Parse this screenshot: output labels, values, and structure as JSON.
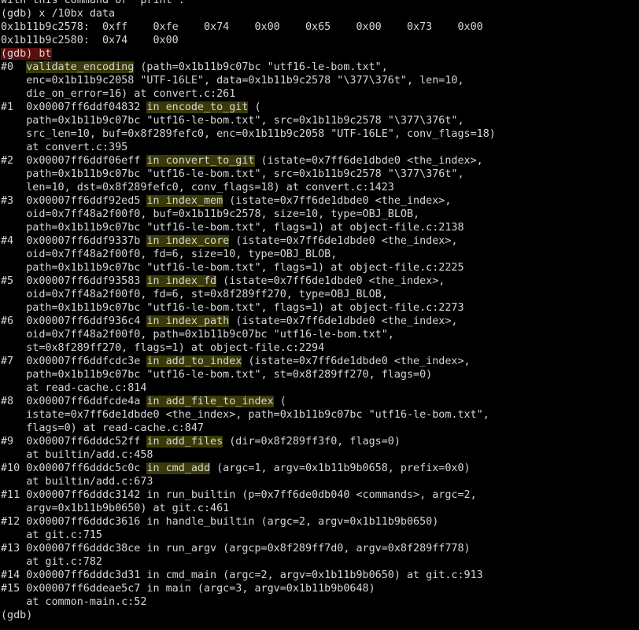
{
  "terminal": {
    "lines": [
      [
        {
          "t": "with this command or \"print\"."
        }
      ],
      [
        {
          "t": "(gdb) x /10bx data"
        }
      ],
      [
        {
          "t": "0x1b11b9c2578:  0xff    0xfe    0x74    0x00    0x65    0x00    0x73    0x00"
        }
      ],
      [
        {
          "t": "0x1b11b9c2580:  0x74    0x00"
        }
      ],
      [
        {
          "t": "(gdb) bt",
          "c": "prompt-hl"
        }
      ],
      [
        {
          "t": "#0  "
        },
        {
          "t": "validate_encoding",
          "c": "hl"
        },
        {
          "t": " (path=0x1b11b9c07bc \"utf16-le-bom.txt\","
        }
      ],
      [
        {
          "t": "    enc=0x1b11b9c2058 \"UTF-16LE\", data=0x1b11b9c2578 \"\\377\\376t\", len=10,"
        }
      ],
      [
        {
          "t": "    die_on_error=16) at convert.c:261"
        }
      ],
      [
        {
          "t": "#1  0x00007ff6ddf04832 "
        },
        {
          "t": "in encode_to_git",
          "c": "hl"
        },
        {
          "t": " ("
        }
      ],
      [
        {
          "t": "    path=0x1b11b9c07bc \"utf16-le-bom.txt\", src=0x1b11b9c2578 \"\\377\\376t\","
        }
      ],
      [
        {
          "t": "    src_len=10, buf=0x8f289fefc0, enc=0x1b11b9c2058 \"UTF-16LE\", conv_flags=18)"
        }
      ],
      [
        {
          "t": "    at convert.c:395"
        }
      ],
      [
        {
          "t": "#2  0x00007ff6ddf06eff "
        },
        {
          "t": "in convert_to_git",
          "c": "hl"
        },
        {
          "t": " (istate=0x7ff6de1dbde0 <the_index>,"
        }
      ],
      [
        {
          "t": "    path=0x1b11b9c07bc \"utf16-le-bom.txt\", src=0x1b11b9c2578 \"\\377\\376t\","
        }
      ],
      [
        {
          "t": "    len=10, dst=0x8f289fefc0, conv_flags=18) at convert.c:1423"
        }
      ],
      [
        {
          "t": "#3  0x00007ff6ddf92ed5 "
        },
        {
          "t": "in index_mem",
          "c": "hl"
        },
        {
          "t": " (istate=0x7ff6de1dbde0 <the_index>,"
        }
      ],
      [
        {
          "t": "    oid=0x7ff48a2f00f0, buf=0x1b11b9c2578, size=10, type=OBJ_BLOB,"
        }
      ],
      [
        {
          "t": "    path=0x1b11b9c07bc \"utf16-le-bom.txt\", flags=1) at object-file.c:2138"
        }
      ],
      [
        {
          "t": "#4  0x00007ff6ddf9337b "
        },
        {
          "t": "in index_core",
          "c": "hl"
        },
        {
          "t": " (istate=0x7ff6de1dbde0 <the_index>,"
        }
      ],
      [
        {
          "t": "    oid=0x7ff48a2f00f0, fd=6, size=10, type=OBJ_BLOB,"
        }
      ],
      [
        {
          "t": "    path=0x1b11b9c07bc \"utf16-le-bom.txt\", flags=1) at object-file.c:2225"
        }
      ],
      [
        {
          "t": "#5  0x00007ff6ddf93583 "
        },
        {
          "t": "in index_fd",
          "c": "hl"
        },
        {
          "t": " (istate=0x7ff6de1dbde0 <the_index>,"
        }
      ],
      [
        {
          "t": "    oid=0x7ff48a2f00f0, fd=6, st=0x8f289ff270, type=OBJ_BLOB,"
        }
      ],
      [
        {
          "t": "    path=0x1b11b9c07bc \"utf16-le-bom.txt\", flags=1) at object-file.c:2273"
        }
      ],
      [
        {
          "t": "#6  0x00007ff6ddf936c4 "
        },
        {
          "t": "in index_path",
          "c": "hl"
        },
        {
          "t": " (istate=0x7ff6de1dbde0 <the_index>,"
        }
      ],
      [
        {
          "t": "    oid=0x7ff48a2f00f0, path=0x1b11b9c07bc \"utf16-le-bom.txt\","
        }
      ],
      [
        {
          "t": "    st=0x8f289ff270, flags=1) at object-file.c:2294"
        }
      ],
      [
        {
          "t": "#7  0x00007ff6ddfcdc3e "
        },
        {
          "t": "in add_to_index",
          "c": "hl"
        },
        {
          "t": " (istate=0x7ff6de1dbde0 <the_index>,"
        }
      ],
      [
        {
          "t": "    path=0x1b11b9c07bc \"utf16-le-bom.txt\", st=0x8f289ff270, flags=0)"
        }
      ],
      [
        {
          "t": "    at read-cache.c:814"
        }
      ],
      [
        {
          "t": "#8  0x00007ff6ddfcde4a "
        },
        {
          "t": "in add_file_to_index",
          "c": "hl"
        },
        {
          "t": " ("
        }
      ],
      [
        {
          "t": "    istate=0x7ff6de1dbde0 <the_index>, path=0x1b11b9c07bc \"utf16-le-bom.txt\","
        }
      ],
      [
        {
          "t": "    flags=0) at read-cache.c:847"
        }
      ],
      [
        {
          "t": "#9  0x00007ff6dddc52ff "
        },
        {
          "t": "in add_files",
          "c": "hl"
        },
        {
          "t": " (dir=0x8f289ff3f0, flags=0)"
        }
      ],
      [
        {
          "t": "    at builtin/add.c:458"
        }
      ],
      [
        {
          "t": "#10 0x00007ff6dddc5c0c "
        },
        {
          "t": "in cmd_add",
          "c": "hl"
        },
        {
          "t": " (argc=1, argv=0x1b11b9b0658, prefix=0x0)"
        }
      ],
      [
        {
          "t": "    at builtin/add.c:673"
        }
      ],
      [
        {
          "t": "#11 0x00007ff6dddc3142 in run_builtin (p=0x7ff6de0db040 <commands>, argc=2,"
        }
      ],
      [
        {
          "t": "    argv=0x1b11b9b0650) at git.c:461"
        }
      ],
      [
        {
          "t": "#12 0x00007ff6dddc3616 in handle_builtin (argc=2, argv=0x1b11b9b0650)"
        }
      ],
      [
        {
          "t": "    at git.c:715"
        }
      ],
      [
        {
          "t": "#13 0x00007ff6dddc38ce in run_argv (argcp=0x8f289ff7d0, argv=0x8f289ff778)"
        }
      ],
      [
        {
          "t": "    at git.c:782"
        }
      ],
      [
        {
          "t": "#14 0x00007ff6dddc3d31 in cmd_main (argc=2, argv=0x1b11b9b0650) at git.c:913"
        }
      ],
      [
        {
          "t": "#15 0x00007ff6ddeae5c7 in main (argc=3, argv=0x1b11b9b0648)"
        }
      ],
      [
        {
          "t": "    at common-main.c:52"
        }
      ],
      [
        {
          "t": "(gdb) "
        }
      ]
    ]
  },
  "colors": {
    "background": "#000000",
    "foreground": "#d6d6d6",
    "prompt_highlight": "#5a0e0e",
    "frame_highlight": "#3a3a08"
  }
}
